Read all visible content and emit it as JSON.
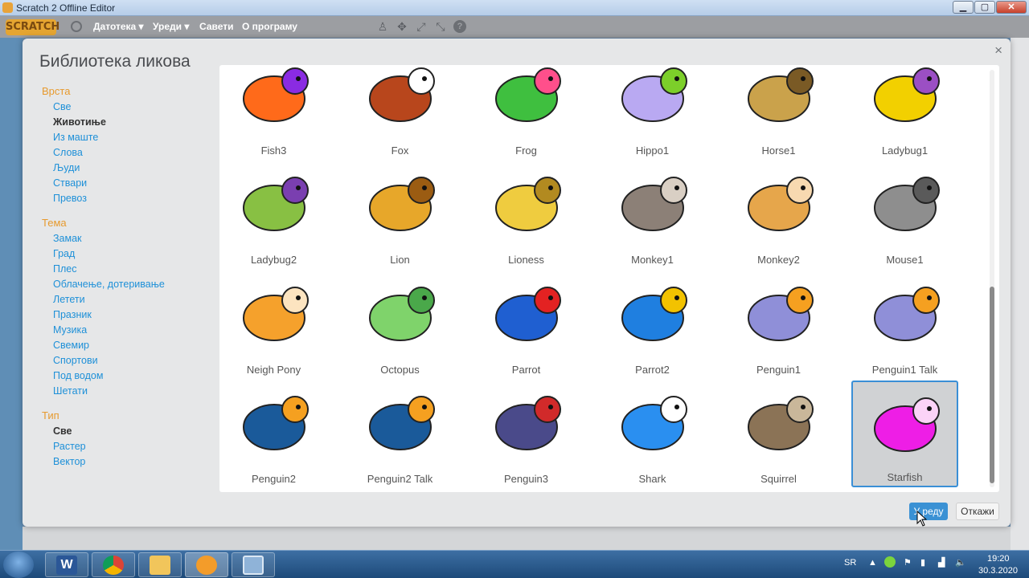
{
  "window": {
    "title": "Scratch 2 Offline Editor",
    "min": "▁",
    "max": "▢",
    "close": "✕"
  },
  "menubar": {
    "logo": "SCRATCH",
    "items": [
      "Датотека ▾",
      "Уреди ▾",
      "Савети",
      "О програму"
    ],
    "tools": [
      "person-stamp-icon",
      "cross-arrows-icon",
      "expand-icon",
      "shrink-icon",
      "help-icon"
    ]
  },
  "dialog": {
    "title": "Библиотека ликова",
    "close": "×",
    "ok_label": "У реду",
    "cancel_label": "Откажи"
  },
  "sidebar": {
    "sections": [
      {
        "heading": "Врста",
        "items": [
          "Све",
          "Животиње",
          "Из маште",
          "Слова",
          "Људи",
          "Ствари",
          "Превоз"
        ],
        "active": "Животиње"
      },
      {
        "heading": "Тема",
        "items": [
          "Замак",
          "Град",
          "Плес",
          "Облачење, дотеривање",
          "Летети",
          "Празник",
          "Музика",
          "Свемир",
          "Спортови",
          "Под водом",
          "Шетати"
        ],
        "active": ""
      },
      {
        "heading": "Тип",
        "items": [
          "Све",
          "Растер",
          "Вектор"
        ],
        "active": "Све"
      }
    ]
  },
  "sprites": [
    {
      "name": "Fish3",
      "color": "#ff6a1a",
      "accent": "#8a2be2"
    },
    {
      "name": "Fox",
      "color": "#b8461c",
      "accent": "#ffffff"
    },
    {
      "name": "Frog",
      "color": "#3fbf3f",
      "accent": "#ff4f8b"
    },
    {
      "name": "Hippo1",
      "color": "#b9a9f2",
      "accent": "#7ccf2a"
    },
    {
      "name": "Horse1",
      "color": "#caa24b",
      "accent": "#7a5a25"
    },
    {
      "name": "Ladybug1",
      "color": "#f2d000",
      "accent": "#9b4fc4"
    },
    {
      "name": "Ladybug2",
      "color": "#88c043",
      "accent": "#7a3fb0"
    },
    {
      "name": "Lion",
      "color": "#e7a72a",
      "accent": "#9b5c12"
    },
    {
      "name": "Lioness",
      "color": "#efcc3f",
      "accent": "#b28a20"
    },
    {
      "name": "Monkey1",
      "color": "#8c8077",
      "accent": "#d9cfc4"
    },
    {
      "name": "Monkey2",
      "color": "#e6a64b",
      "accent": "#f7d9b0"
    },
    {
      "name": "Mouse1",
      "color": "#8e8e8e",
      "accent": "#5a5a5a"
    },
    {
      "name": "Neigh Pony",
      "color": "#f5a12c",
      "accent": "#fce4c0"
    },
    {
      "name": "Octopus",
      "color": "#7fd36b",
      "accent": "#4aa84a"
    },
    {
      "name": "Parrot",
      "color": "#1f5fd1",
      "accent": "#e32222"
    },
    {
      "name": "Parrot2",
      "color": "#1f7fe0",
      "accent": "#f2c200"
    },
    {
      "name": "Penguin1",
      "color": "#8f8fd8",
      "accent": "#f5a020"
    },
    {
      "name": "Penguin1 Talk",
      "color": "#8f8fd8",
      "accent": "#f5a020"
    },
    {
      "name": "Penguin2",
      "color": "#1a5a9a",
      "accent": "#f5a020"
    },
    {
      "name": "Penguin2 Talk",
      "color": "#1a5a9a",
      "accent": "#f5a020"
    },
    {
      "name": "Penguin3",
      "color": "#4a4a8a",
      "accent": "#d12a2a"
    },
    {
      "name": "Shark",
      "color": "#2a8ff0",
      "accent": "#ffffff"
    },
    {
      "name": "Squirrel",
      "color": "#8b7356",
      "accent": "#c9b79a"
    },
    {
      "name": "Starfish",
      "color": "#ee1ee6",
      "accent": "#fbd3f7"
    }
  ],
  "selected_sprite": "Starfish",
  "taskbar": {
    "apps": [
      "Word",
      "Chrome",
      "Explorer",
      "Scratch",
      "Picture"
    ],
    "lang": "SR",
    "time": "19:20",
    "date": "30.3.2020"
  }
}
